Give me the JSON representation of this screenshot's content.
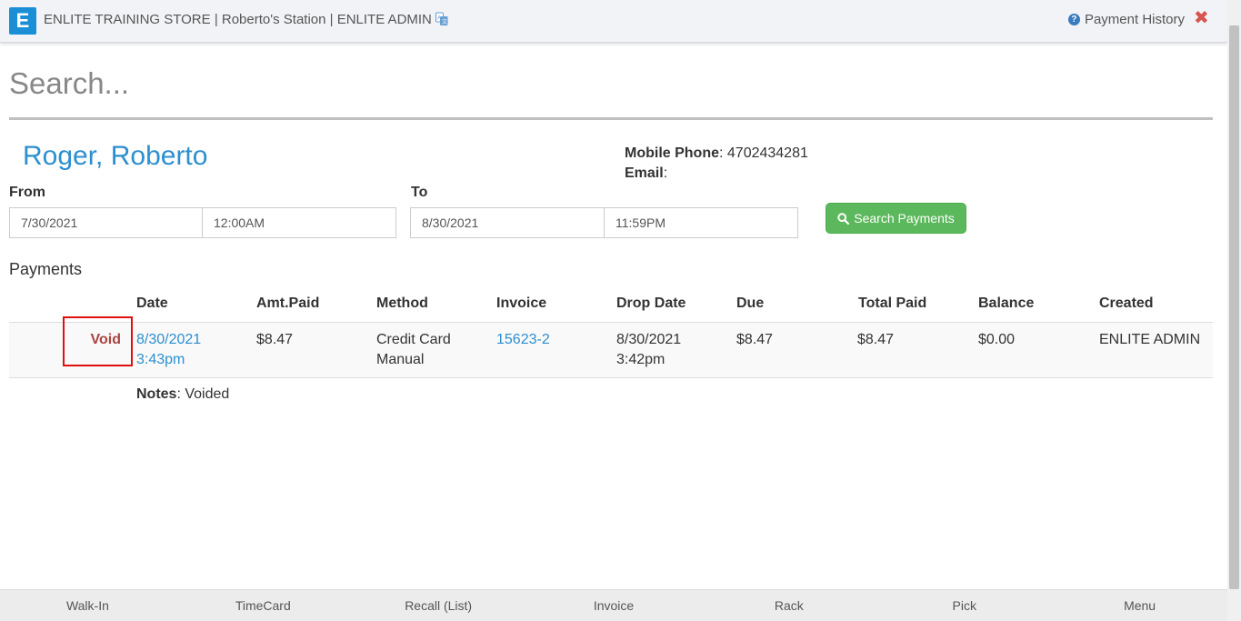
{
  "header": {
    "logo_letter": "E",
    "title": "ENLITE TRAINING STORE | Roberto's Station | ENLITE ADMIN",
    "payment_history_label": "Payment History",
    "help_icon": "?",
    "close_icon": "✖"
  },
  "search": {
    "placeholder": "Search..."
  },
  "customer": {
    "name": "Roger, Roberto",
    "mobile_label": "Mobile Phone",
    "mobile_value": ": 4702434281",
    "email_label": "Email",
    "email_value": ":"
  },
  "filters": {
    "from_label": "From",
    "from_date": "7/30/2021",
    "from_time": "12:00AM",
    "to_label": "To",
    "to_date": "8/30/2021",
    "to_time": "11:59PM",
    "search_button": "Search Payments"
  },
  "payments": {
    "title": "Payments",
    "columns": [
      "Date",
      "Amt.Paid",
      "Method",
      "Invoice",
      "Drop Date",
      "Due",
      "Total Paid",
      "Balance",
      "Created"
    ],
    "rows": [
      {
        "action": "Void",
        "date_line1": "8/30/2021",
        "date_line2": "3:43pm",
        "amt_paid": "$8.47",
        "method_line1": "Credit Card",
        "method_line2": "Manual",
        "invoice": "15623-2",
        "drop_date_line1": "8/30/2021",
        "drop_date_line2": "3:42pm",
        "due": "$8.47",
        "total_paid": "$8.47",
        "balance": "$0.00",
        "created": "ENLITE ADMIN"
      }
    ],
    "notes_label": "Notes",
    "notes_value": ": Voided"
  },
  "bottom_nav": [
    "Walk-In",
    "TimeCard",
    "Recall (List)",
    "Invoice",
    "Rack",
    "Pick",
    "Menu"
  ],
  "colors": {
    "brand": "#1a8fd6",
    "link": "#2c8fd0",
    "success": "#5cb85c",
    "danger": "#d9534f",
    "void_text": "#a94442"
  },
  "icons": {
    "translate": "translate-icon",
    "search": "search-icon",
    "help": "help-icon",
    "close": "close-icon"
  }
}
